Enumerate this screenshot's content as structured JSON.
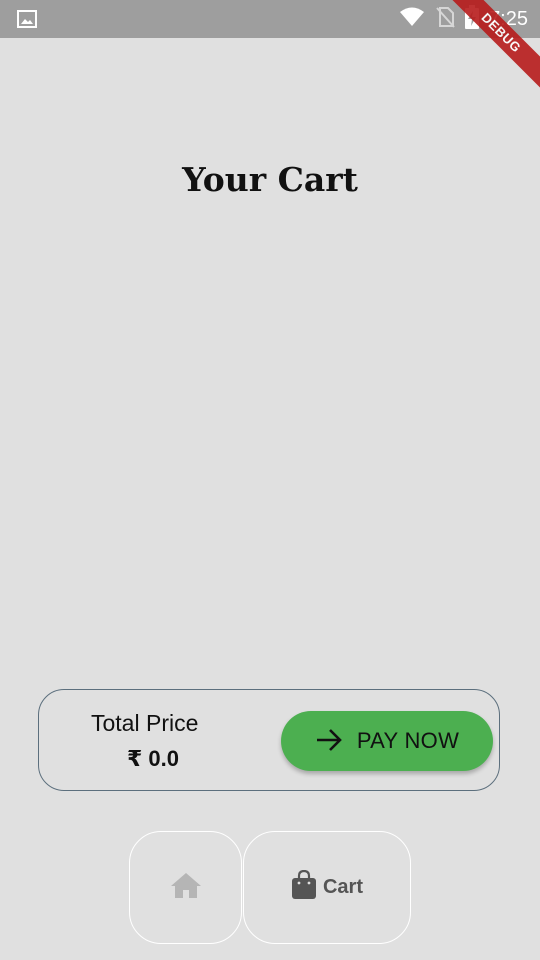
{
  "status_bar": {
    "time": "7:25",
    "left_icon": "image-icon",
    "right_icons": [
      "wifi-icon",
      "no-sim-icon",
      "battery-charging-icon"
    ]
  },
  "debug_banner": "DEBUG",
  "page": {
    "title": "Your Cart"
  },
  "summary": {
    "total_label": "Total Price",
    "total_value": "₹ 0.0",
    "pay_button_label": "PAY NOW",
    "pay_button_icon": "arrow-right-icon",
    "pay_button_color": "#4caf50"
  },
  "bottom_nav": {
    "home_icon": "home-icon",
    "cart_icon": "shopping-bag-icon",
    "cart_label": "Cart"
  }
}
